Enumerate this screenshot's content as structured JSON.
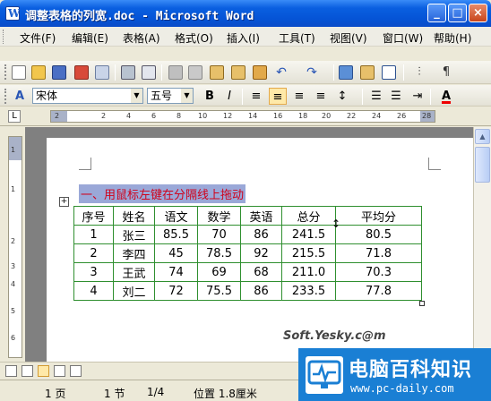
{
  "window": {
    "title": "调整表格的列宽.doc - Microsoft Word"
  },
  "menu": [
    "文件(F)",
    "编辑(E)",
    "表格(A)",
    "格式(O)",
    "插入(I)",
    "工具(T)",
    "视图(V)",
    "窗口(W)",
    "帮助(H)"
  ],
  "formatting": {
    "style_label": "A",
    "font_name": "宋体",
    "font_size": "五号",
    "bold": "B",
    "italic": "I",
    "font_color_label": "A"
  },
  "ruler": {
    "h_ticks": [
      "2",
      "2",
      "4",
      "6",
      "8",
      "10",
      "12",
      "14",
      "16",
      "18",
      "20",
      "22",
      "24",
      "26",
      "28"
    ],
    "v_ticks": [
      "1",
      "1",
      "2",
      "3",
      "4",
      "5",
      "6"
    ]
  },
  "document": {
    "heading": "一、用鼠标左键在分隔线上拖动",
    "anchor_symbol": "+",
    "split_cursor": "↕",
    "table": {
      "headers": [
        "序号",
        "姓名",
        "语文",
        "数学",
        "英语",
        "总分",
        "平均分"
      ],
      "rows": [
        [
          "1",
          "张三",
          "85.5",
          "70",
          "86",
          "241.5",
          "80.5"
        ],
        [
          "2",
          "李四",
          "45",
          "78.5",
          "92",
          "215.5",
          "71.8"
        ],
        [
          "3",
          "王武",
          "74",
          "69",
          "68",
          "211.0",
          "70.3"
        ],
        [
          "4",
          "刘二",
          "72",
          "75.5",
          "86",
          "233.5",
          "77.8"
        ]
      ]
    },
    "watermark": "Soft.Yesky.c@m"
  },
  "status": {
    "page": "1 页",
    "section": "1 节",
    "page_of": "1/4",
    "position": "位置 1.8厘米"
  },
  "brand": {
    "title": "电脑百科知识",
    "url": "www.pc-daily.com"
  },
  "colors": {
    "titlebar": "#0554D6",
    "heading_text": "#d0021b",
    "heading_highlight": "#9aa8d8",
    "table_border": "#2f8f2f",
    "brand_bg": "#1a7fd4"
  }
}
